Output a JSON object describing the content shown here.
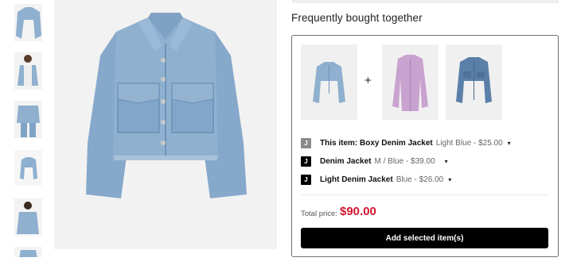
{
  "section": {
    "title": "Frequently bought together"
  },
  "items": [
    {
      "checkbox_mark": "J",
      "name": "This item: Boxy Denim Jacket",
      "variant": "Light Blue - $25.00",
      "caret": "▾"
    },
    {
      "checkbox_mark": "J",
      "name": "Denim Jacket",
      "variant": "M / Blue - $39.00",
      "caret": "▾"
    },
    {
      "checkbox_mark": "J",
      "name": "Light Denim Jacket",
      "variant": "Blue - $26.00",
      "caret": "▾"
    }
  ],
  "bundle": {
    "plus_sign": "+"
  },
  "total": {
    "label": "Total price:",
    "price": "$90.00"
  },
  "actions": {
    "add_label": "Add selected item(s)"
  },
  "colors": {
    "accent_price": "#d0142c",
    "button_bg": "#000000",
    "denim_light": "#8fb0cf",
    "lilac": "#c9a3cf",
    "denim_dark": "#5a7fa8"
  },
  "icons": {
    "checkbox": "check-square-icon",
    "dropdown": "chevron-down-icon"
  }
}
